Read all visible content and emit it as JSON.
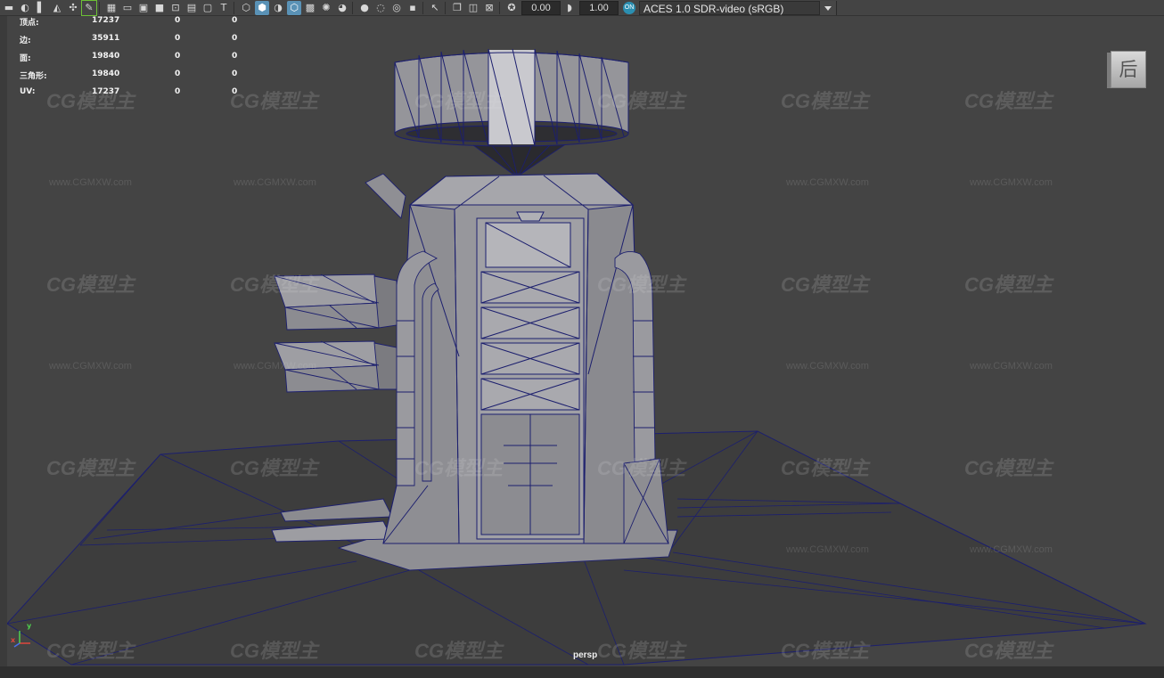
{
  "toolbar": {
    "icons_left": [
      "camera-icon",
      "camera-attr-icon",
      "bookmark-icon",
      "image-plane-icon",
      "grid-icon",
      "pencil-icon"
    ],
    "icons_mid": [
      "grid-toggle-icon",
      "film-gate-icon",
      "resolution-gate-icon",
      "safe-action-icon",
      "field-chart-icon",
      "safe-title-icon",
      "gate-mask-icon",
      "text-icon",
      "wireframe-icon",
      "smooth-shade-icon",
      "shade-all-icon",
      "textured-icon",
      "xray-icon",
      "use-lights-icon",
      "shadows-icon",
      "ambient-occlusion-icon",
      "motion-blur-icon",
      "antialias-icon",
      "dof-icon",
      "isolate-icon",
      "xray-joints-icon",
      "backface-icon",
      "select-highlight-icon"
    ],
    "exposure_value": "0.00",
    "gamma_value": "1.00",
    "colorspace_badge": "ON",
    "colorspace": "ACES 1.0 SDR-video (sRGB)"
  },
  "hud": {
    "rows": [
      {
        "label": "顶点:",
        "v1": "17237",
        "v2": "0",
        "v3": "0"
      },
      {
        "label": "边:",
        "v1": "35911",
        "v2": "0",
        "v3": "0"
      },
      {
        "label": "面:",
        "v1": "19840",
        "v2": "0",
        "v3": "0"
      },
      {
        "label": "三角形:",
        "v1": "19840",
        "v2": "0",
        "v3": "0"
      },
      {
        "label": "UV:",
        "v1": "17237",
        "v2": "0",
        "v3": "0"
      }
    ]
  },
  "viewcube": {
    "face_label": "后"
  },
  "camera_label": "persp",
  "axis": {
    "y": "y",
    "x": "x"
  },
  "watermark": {
    "logo_text": "CG模型主",
    "url_text": "www.CGMXW.com"
  },
  "colors": {
    "viewport_bg": "#444444",
    "wire_color": "#1c1f6e",
    "mesh_light": "#9a9a9e",
    "accent": "#5a92b6"
  }
}
